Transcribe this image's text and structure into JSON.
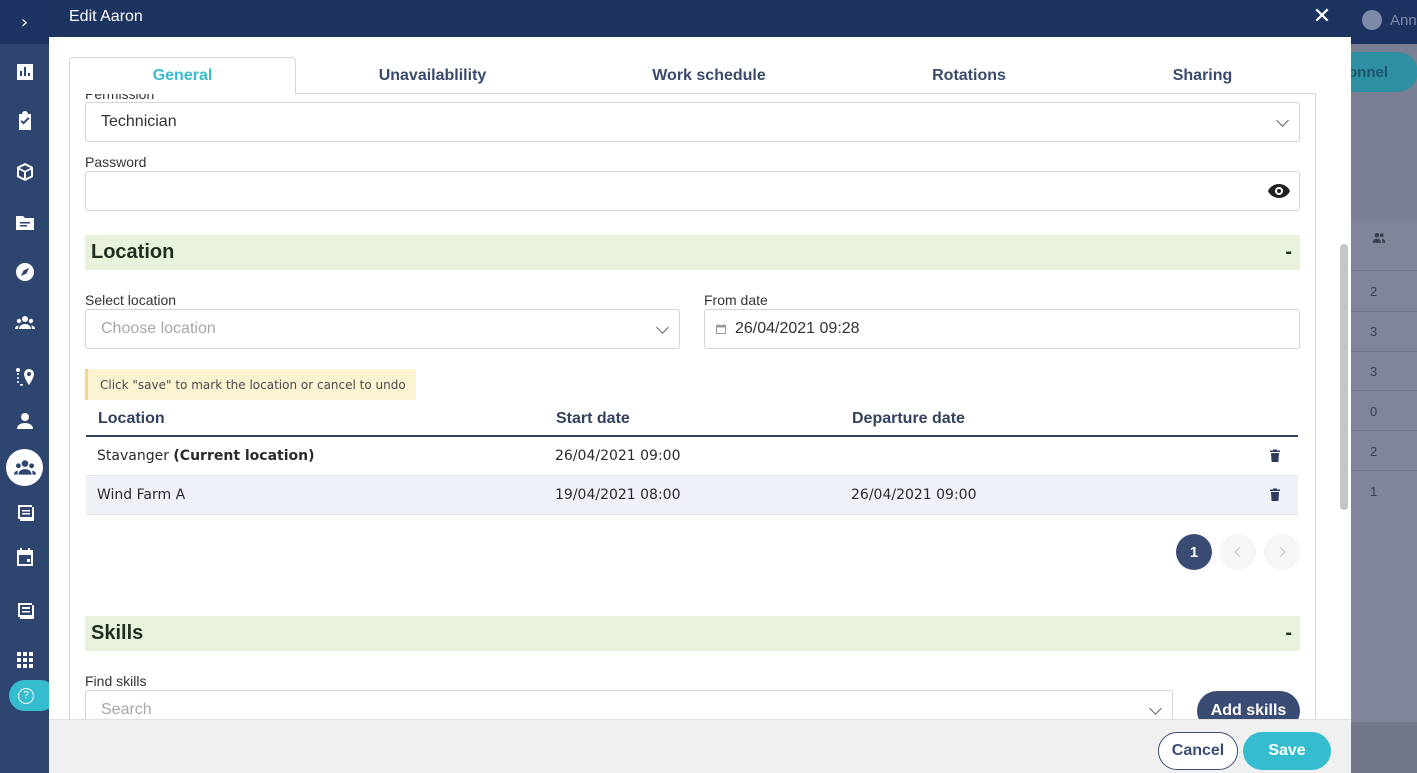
{
  "modal": {
    "title": "Edit Aaron",
    "close_glyph": "✕"
  },
  "tabs": [
    {
      "label": "General",
      "active": true
    },
    {
      "label": "Unavailablility",
      "active": false
    },
    {
      "label": "Work schedule",
      "active": false
    },
    {
      "label": "Rotations",
      "active": false
    },
    {
      "label": "Sharing",
      "active": false
    }
  ],
  "general": {
    "permission_label": "Permission",
    "permission_value": "Technician",
    "password_label": "Password",
    "password_value": ""
  },
  "location": {
    "section_title": "Location",
    "collapse_glyph": "-",
    "select_label": "Select location",
    "select_placeholder": "Choose location",
    "from_date_label": "From date",
    "from_date_value": "26/04/2021 09:28",
    "hint": "Click \"save\" to mark the location or cancel to undo",
    "table": {
      "headers": [
        "Location",
        "Start date",
        "Departure date"
      ],
      "rows": [
        {
          "location": "Stavanger",
          "tag": "(Current location)",
          "start": "26/04/2021 09:00",
          "departure": ""
        },
        {
          "location": "Wind Farm A",
          "tag": "",
          "start": "19/04/2021 08:00",
          "departure": "26/04/2021 09:00"
        }
      ]
    },
    "pagination": {
      "current": "1"
    }
  },
  "skills": {
    "section_title": "Skills",
    "collapse_glyph": "-",
    "find_label": "Find skills",
    "search_placeholder": "Search",
    "add_button": "Add skills"
  },
  "footer": {
    "cancel": "Cancel",
    "save": "Save"
  },
  "background": {
    "user_text": "Ann",
    "pill_text": "sonnel",
    "numbers": [
      "2",
      "3",
      "3",
      "0",
      "2",
      "1"
    ]
  },
  "sidebar": {
    "expand_glyph": "›",
    "help_glyph": "?"
  },
  "colors": {
    "header": "#1d3461",
    "accent": "#36bccf",
    "primary": "#3b4c74",
    "section_bg": "#e9f3dc"
  }
}
